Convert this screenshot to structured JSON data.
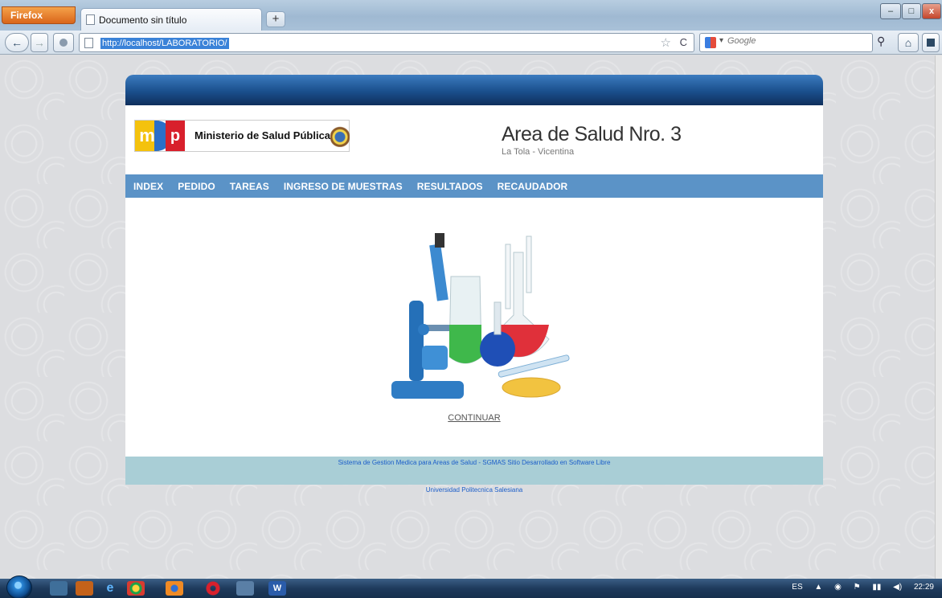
{
  "browser": {
    "menu_button": "Firefox",
    "tab_title": "Documento sin título",
    "new_tab": "+",
    "url": "http://localhost/LABORATORIO/",
    "search_placeholder": "Google",
    "back": "←",
    "forward": "→",
    "reload": "C",
    "star": "☆",
    "home_icon": "home-icon",
    "window_minimize": "–",
    "window_maximize": "□",
    "window_close": "x"
  },
  "site": {
    "ministry_logo_m": "m",
    "ministry_logo_p": "p",
    "ministry_name": "Ministerio de Salud Pública",
    "area_title": "Area de Salud Nro. 3",
    "area_subtitle": "La Tola - Vicentina",
    "menu": [
      {
        "label": "INDEX"
      },
      {
        "label": "PEDIDO"
      },
      {
        "label": "TAREAS"
      },
      {
        "label": "INGRESO DE MUESTRAS"
      },
      {
        "label": "RESULTADOS"
      },
      {
        "label": "RECAUDADOR"
      }
    ],
    "continue_link": "CONTINUAR",
    "footer_text": "Sistema de Gestion Medica para Areas de Salud - SGMAS Sitio Desarrollado en Software Libre",
    "university": "Universidad Politecnica Salesiana"
  },
  "taskbar": {
    "language": "ES",
    "clock": "22:29"
  },
  "colors": {
    "menu_bar": "#5b93c7",
    "footer_bar": "#a9ced6",
    "header_gradient_dark": "#0f2f5c",
    "url_highlight": "#3a82d8"
  }
}
